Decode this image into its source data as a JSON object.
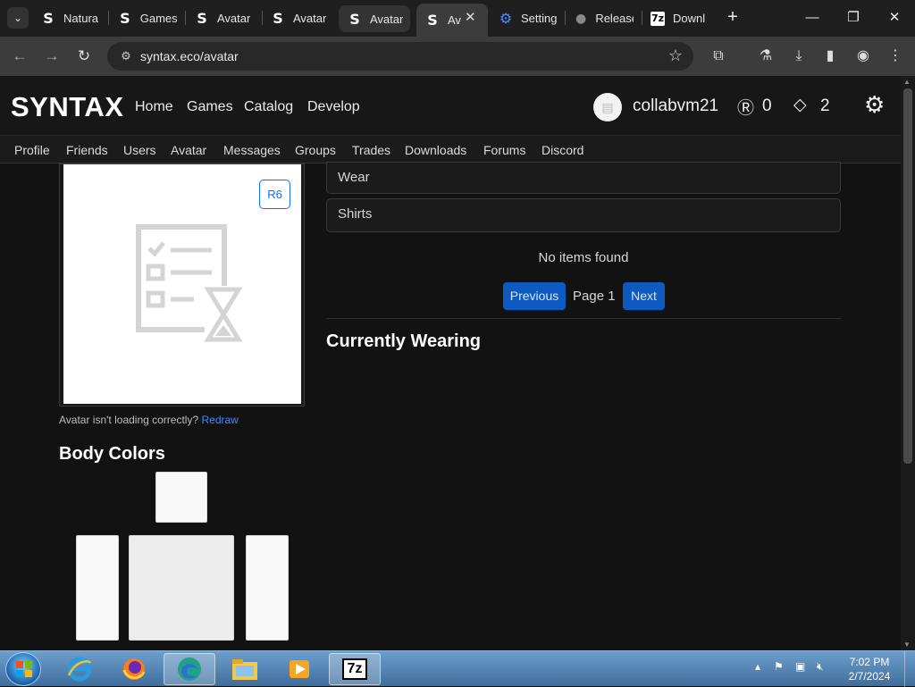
{
  "browser": {
    "tabs": [
      {
        "label": "Natura",
        "favicon": "S"
      },
      {
        "label": "Games",
        "favicon": "S"
      },
      {
        "label": "Avatar",
        "favicon": "S"
      },
      {
        "label": "Avatar",
        "favicon": "S"
      },
      {
        "label": "Avatar",
        "favicon": "S"
      },
      {
        "label": "Av",
        "favicon": "S"
      },
      {
        "label": "Setting",
        "favicon": "gear-icon"
      },
      {
        "label": "Release",
        "favicon": "github-icon"
      },
      {
        "label": "Downl",
        "favicon": "7z"
      }
    ],
    "url": "syntax.eco/avatar"
  },
  "site": {
    "logo": "SYNTAX",
    "nav": [
      "Home",
      "Games",
      "Catalog",
      "Develop"
    ],
    "username": "collabvm21",
    "robux": "0",
    "tickets": "2",
    "subnav": [
      "Profile",
      "Friends",
      "Users",
      "Avatar",
      "Messages",
      "Groups",
      "Trades",
      "Downloads",
      "Forums",
      "Discord"
    ]
  },
  "avatar": {
    "rig_button": "R6",
    "redraw_text": "Avatar isn't loading correctly?",
    "redraw_link": "Redraw",
    "body_colors_title": "Body Colors",
    "colors": {
      "head": "#f8f8f8",
      "torso": "#ececec",
      "left_arm": "#f8f8f8",
      "right_arm": "#f8f8f8"
    }
  },
  "inventory": {
    "mode_select": "Wear",
    "category_select": "Shirts",
    "empty_text": "No items found",
    "previous": "Previous",
    "page_label": "Page 1",
    "next": "Next",
    "currently_wearing": "Currently Wearing"
  },
  "taskbar": {
    "time": "7:02 PM",
    "date": "2/7/2024",
    "apps": [
      "internet-explorer-icon",
      "firefox-icon",
      "edge-icon",
      "explorer-icon",
      "media-player-icon",
      "7zip-icon"
    ],
    "sevenzip_label": "7z"
  }
}
